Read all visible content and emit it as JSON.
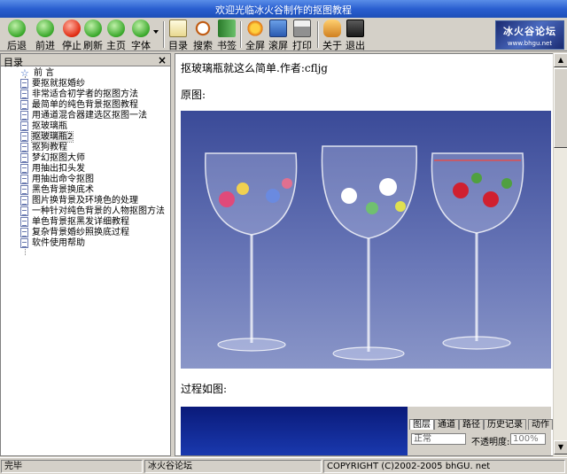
{
  "window": {
    "title": "欢迎光临冰火谷制作的抠图教程"
  },
  "toolbar": {
    "buttons": [
      {
        "label": "后退",
        "icon": "back-arrow-icon"
      },
      {
        "label": "前进",
        "icon": "forward-arrow-icon"
      },
      {
        "label": "停止",
        "icon": "stop-icon"
      },
      {
        "label": "刷新",
        "icon": "refresh-icon"
      },
      {
        "label": "主页",
        "icon": "home-icon"
      },
      {
        "label": "字体",
        "icon": "font-icon"
      },
      {
        "label": "目录",
        "icon": "contents-icon"
      },
      {
        "label": "搜索",
        "icon": "search-icon"
      },
      {
        "label": "书签",
        "icon": "bookmark-icon"
      },
      {
        "label": "全屏",
        "icon": "fullscreen-icon"
      },
      {
        "label": "滚屏",
        "icon": "scroll-icon"
      },
      {
        "label": "打印",
        "icon": "print-icon"
      },
      {
        "label": "关于",
        "icon": "about-icon"
      },
      {
        "label": "退出",
        "icon": "exit-icon"
      }
    ],
    "logo": {
      "line1": "冰火谷论坛",
      "line2": "www.bhgu.net"
    }
  },
  "tree": {
    "header": "目录",
    "close_label": "×",
    "items": [
      {
        "label": "前 言",
        "icon": "star-icon"
      },
      {
        "label": "要抠就抠婚纱",
        "icon": "page-icon"
      },
      {
        "label": "非常适合初学者的抠图方法",
        "icon": "page-icon"
      },
      {
        "label": "最简单的纯色背景抠图教程",
        "icon": "page-icon"
      },
      {
        "label": "用通道混合器建选区抠图一法",
        "icon": "page-icon"
      },
      {
        "label": "抠玻璃瓶",
        "icon": "page-icon"
      },
      {
        "label": "抠玻璃瓶2",
        "icon": "page-icon",
        "selected": true
      },
      {
        "label": "抠狗教程",
        "icon": "page-icon"
      },
      {
        "label": "梦幻抠图大师",
        "icon": "page-icon"
      },
      {
        "label": "用抽出扣头发",
        "icon": "page-icon"
      },
      {
        "label": "用抽出命令抠图",
        "icon": "page-icon"
      },
      {
        "label": "黑色背景换底术",
        "icon": "page-icon"
      },
      {
        "label": "图片换背景及环境色的处理",
        "icon": "page-icon"
      },
      {
        "label": "一种针对纯色背景的人物抠图方法",
        "icon": "page-icon"
      },
      {
        "label": "单色背景抠黑发详细教程",
        "icon": "page-icon"
      },
      {
        "label": "复杂背景婚纱照换底过程",
        "icon": "page-icon"
      },
      {
        "label": "软件使用帮助",
        "icon": "page-icon"
      }
    ]
  },
  "content": {
    "heading": "抠玻璃瓶就这么简单.作者:cfljg",
    "original_label": "原图:",
    "process_label": "过程如图:",
    "ps_panel": {
      "tabs": [
        "图层",
        "通道",
        "路径",
        "历史记录",
        "动作"
      ],
      "blend_mode": "正常",
      "opacity_label": "不透明度:",
      "opacity_value": "100%"
    }
  },
  "statusbar": {
    "status": "完毕",
    "forum": "冰火谷论坛",
    "copyright": "COPYRIGHT (C)2002-2005 bhGU. net"
  },
  "colors": {
    "titlebar": "#2a5fd0",
    "chrome": "#d4d0c8",
    "photo_bg": "#4a5aa8"
  }
}
